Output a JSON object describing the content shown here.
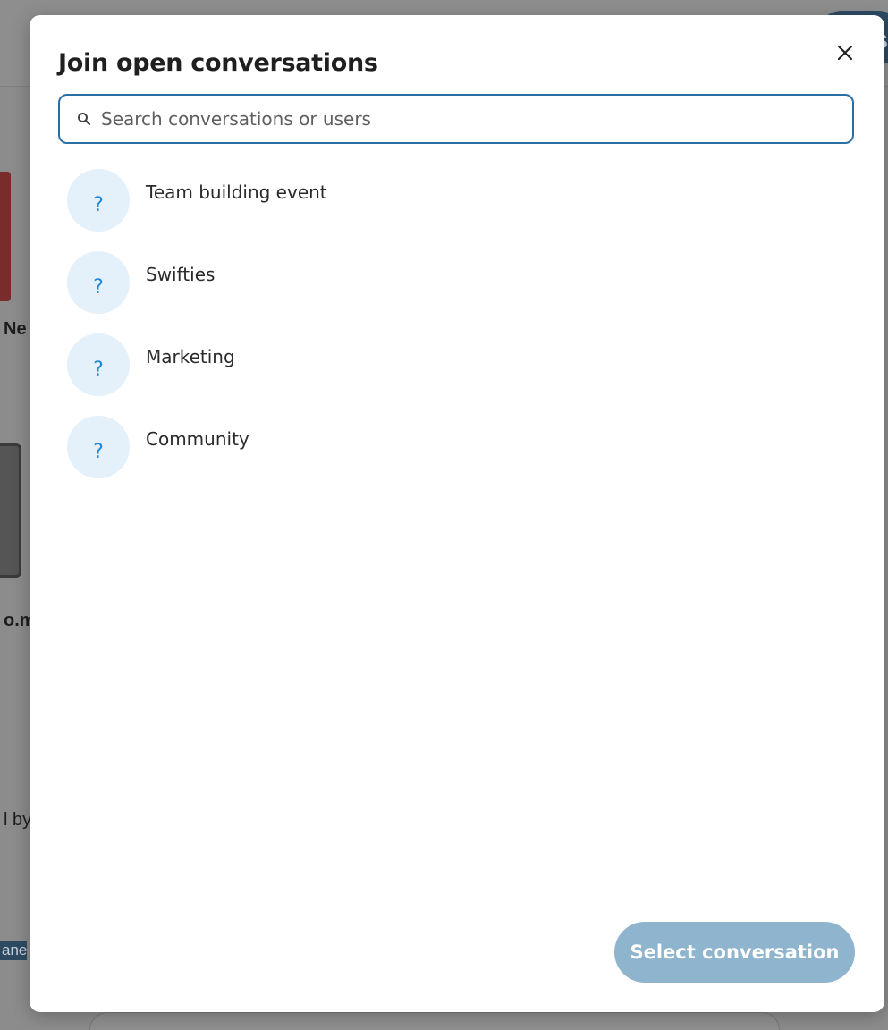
{
  "background": {
    "top_pill_text": "S",
    "text_ne": "Ne",
    "text_om": "o.m",
    "text_by": "l by",
    "tag_text": "ane"
  },
  "modal": {
    "title": "Join open conversations",
    "search": {
      "placeholder": "Search conversations or users",
      "value": ""
    },
    "conversations": [
      {
        "avatar": "?",
        "name": "Team building event"
      },
      {
        "avatar": "?",
        "name": "Swifties"
      },
      {
        "avatar": "?",
        "name": "Marketing"
      },
      {
        "avatar": "?",
        "name": "Community"
      }
    ],
    "select_button_label": "Select conversation",
    "select_button_enabled": false
  },
  "colors": {
    "accent": "#2b6ea3",
    "avatar_bg": "#e4f0fa",
    "avatar_fg": "#1e8ad6",
    "button_disabled": "#8fb4cd"
  },
  "icons": {
    "close": "close-icon",
    "search": "search-icon"
  }
}
